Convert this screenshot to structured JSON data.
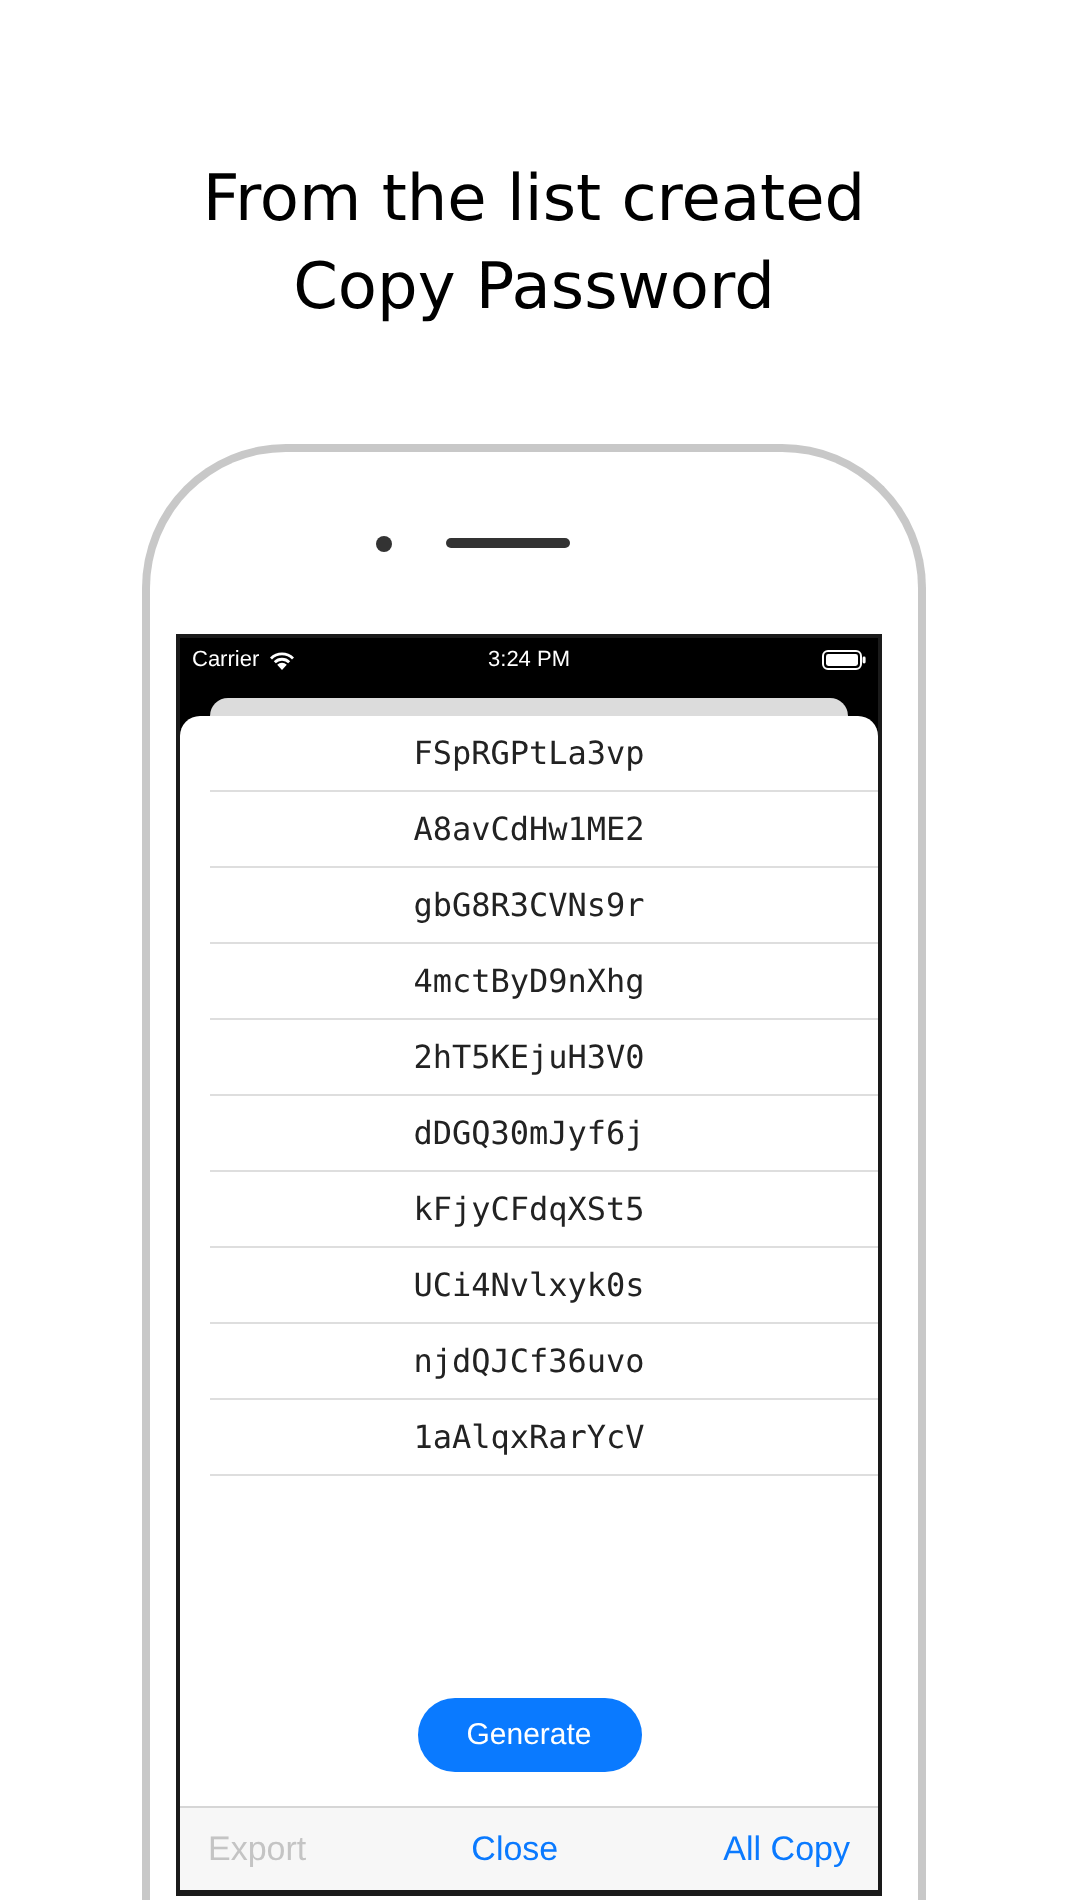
{
  "headline": [
    "From the list created",
    "Copy Password"
  ],
  "status_bar": {
    "carrier": "Carrier",
    "time": "3:24 PM"
  },
  "passwords": [
    "FSpRGPtLa3vp",
    "A8avCdHw1ME2",
    "gbG8R3CVNs9r",
    "4mctByD9nXhg",
    "2hT5KEjuH3V0",
    "dDGQ30mJyf6j",
    "kFjyCFdqXSt5",
    "UCi4Nvlxyk0s",
    "njdQJCf36uvo",
    "1aAlqxRarYcV"
  ],
  "generate_button": "Generate",
  "toolbar": [
    {
      "label": "Export",
      "disabled": true
    },
    {
      "label": "Close",
      "disabled": false
    },
    {
      "label": "All Copy",
      "disabled": false
    }
  ]
}
